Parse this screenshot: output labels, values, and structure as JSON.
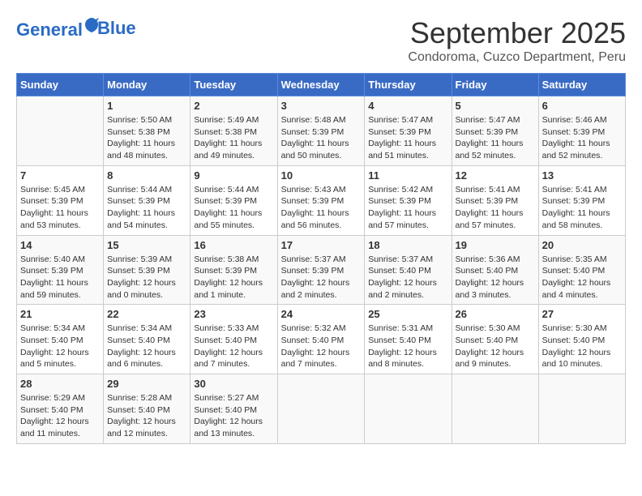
{
  "header": {
    "logo_line1": "General",
    "logo_line2": "Blue",
    "month": "September 2025",
    "location": "Condoroma, Cuzco Department, Peru"
  },
  "days_of_week": [
    "Sunday",
    "Monday",
    "Tuesday",
    "Wednesday",
    "Thursday",
    "Friday",
    "Saturday"
  ],
  "weeks": [
    [
      {
        "day": "",
        "info": ""
      },
      {
        "day": "1",
        "info": "Sunrise: 5:50 AM\nSunset: 5:38 PM\nDaylight: 11 hours\nand 48 minutes."
      },
      {
        "day": "2",
        "info": "Sunrise: 5:49 AM\nSunset: 5:38 PM\nDaylight: 11 hours\nand 49 minutes."
      },
      {
        "day": "3",
        "info": "Sunrise: 5:48 AM\nSunset: 5:39 PM\nDaylight: 11 hours\nand 50 minutes."
      },
      {
        "day": "4",
        "info": "Sunrise: 5:47 AM\nSunset: 5:39 PM\nDaylight: 11 hours\nand 51 minutes."
      },
      {
        "day": "5",
        "info": "Sunrise: 5:47 AM\nSunset: 5:39 PM\nDaylight: 11 hours\nand 52 minutes."
      },
      {
        "day": "6",
        "info": "Sunrise: 5:46 AM\nSunset: 5:39 PM\nDaylight: 11 hours\nand 52 minutes."
      }
    ],
    [
      {
        "day": "7",
        "info": "Sunrise: 5:45 AM\nSunset: 5:39 PM\nDaylight: 11 hours\nand 53 minutes."
      },
      {
        "day": "8",
        "info": "Sunrise: 5:44 AM\nSunset: 5:39 PM\nDaylight: 11 hours\nand 54 minutes."
      },
      {
        "day": "9",
        "info": "Sunrise: 5:44 AM\nSunset: 5:39 PM\nDaylight: 11 hours\nand 55 minutes."
      },
      {
        "day": "10",
        "info": "Sunrise: 5:43 AM\nSunset: 5:39 PM\nDaylight: 11 hours\nand 56 minutes."
      },
      {
        "day": "11",
        "info": "Sunrise: 5:42 AM\nSunset: 5:39 PM\nDaylight: 11 hours\nand 57 minutes."
      },
      {
        "day": "12",
        "info": "Sunrise: 5:41 AM\nSunset: 5:39 PM\nDaylight: 11 hours\nand 57 minutes."
      },
      {
        "day": "13",
        "info": "Sunrise: 5:41 AM\nSunset: 5:39 PM\nDaylight: 11 hours\nand 58 minutes."
      }
    ],
    [
      {
        "day": "14",
        "info": "Sunrise: 5:40 AM\nSunset: 5:39 PM\nDaylight: 11 hours\nand 59 minutes."
      },
      {
        "day": "15",
        "info": "Sunrise: 5:39 AM\nSunset: 5:39 PM\nDaylight: 12 hours\nand 0 minutes."
      },
      {
        "day": "16",
        "info": "Sunrise: 5:38 AM\nSunset: 5:39 PM\nDaylight: 12 hours\nand 1 minute."
      },
      {
        "day": "17",
        "info": "Sunrise: 5:37 AM\nSunset: 5:39 PM\nDaylight: 12 hours\nand 2 minutes."
      },
      {
        "day": "18",
        "info": "Sunrise: 5:37 AM\nSunset: 5:40 PM\nDaylight: 12 hours\nand 2 minutes."
      },
      {
        "day": "19",
        "info": "Sunrise: 5:36 AM\nSunset: 5:40 PM\nDaylight: 12 hours\nand 3 minutes."
      },
      {
        "day": "20",
        "info": "Sunrise: 5:35 AM\nSunset: 5:40 PM\nDaylight: 12 hours\nand 4 minutes."
      }
    ],
    [
      {
        "day": "21",
        "info": "Sunrise: 5:34 AM\nSunset: 5:40 PM\nDaylight: 12 hours\nand 5 minutes."
      },
      {
        "day": "22",
        "info": "Sunrise: 5:34 AM\nSunset: 5:40 PM\nDaylight: 12 hours\nand 6 minutes."
      },
      {
        "day": "23",
        "info": "Sunrise: 5:33 AM\nSunset: 5:40 PM\nDaylight: 12 hours\nand 7 minutes."
      },
      {
        "day": "24",
        "info": "Sunrise: 5:32 AM\nSunset: 5:40 PM\nDaylight: 12 hours\nand 7 minutes."
      },
      {
        "day": "25",
        "info": "Sunrise: 5:31 AM\nSunset: 5:40 PM\nDaylight: 12 hours\nand 8 minutes."
      },
      {
        "day": "26",
        "info": "Sunrise: 5:30 AM\nSunset: 5:40 PM\nDaylight: 12 hours\nand 9 minutes."
      },
      {
        "day": "27",
        "info": "Sunrise: 5:30 AM\nSunset: 5:40 PM\nDaylight: 12 hours\nand 10 minutes."
      }
    ],
    [
      {
        "day": "28",
        "info": "Sunrise: 5:29 AM\nSunset: 5:40 PM\nDaylight: 12 hours\nand 11 minutes."
      },
      {
        "day": "29",
        "info": "Sunrise: 5:28 AM\nSunset: 5:40 PM\nDaylight: 12 hours\nand 12 minutes."
      },
      {
        "day": "30",
        "info": "Sunrise: 5:27 AM\nSunset: 5:40 PM\nDaylight: 12 hours\nand 13 minutes."
      },
      {
        "day": "",
        "info": ""
      },
      {
        "day": "",
        "info": ""
      },
      {
        "day": "",
        "info": ""
      },
      {
        "day": "",
        "info": ""
      }
    ]
  ]
}
